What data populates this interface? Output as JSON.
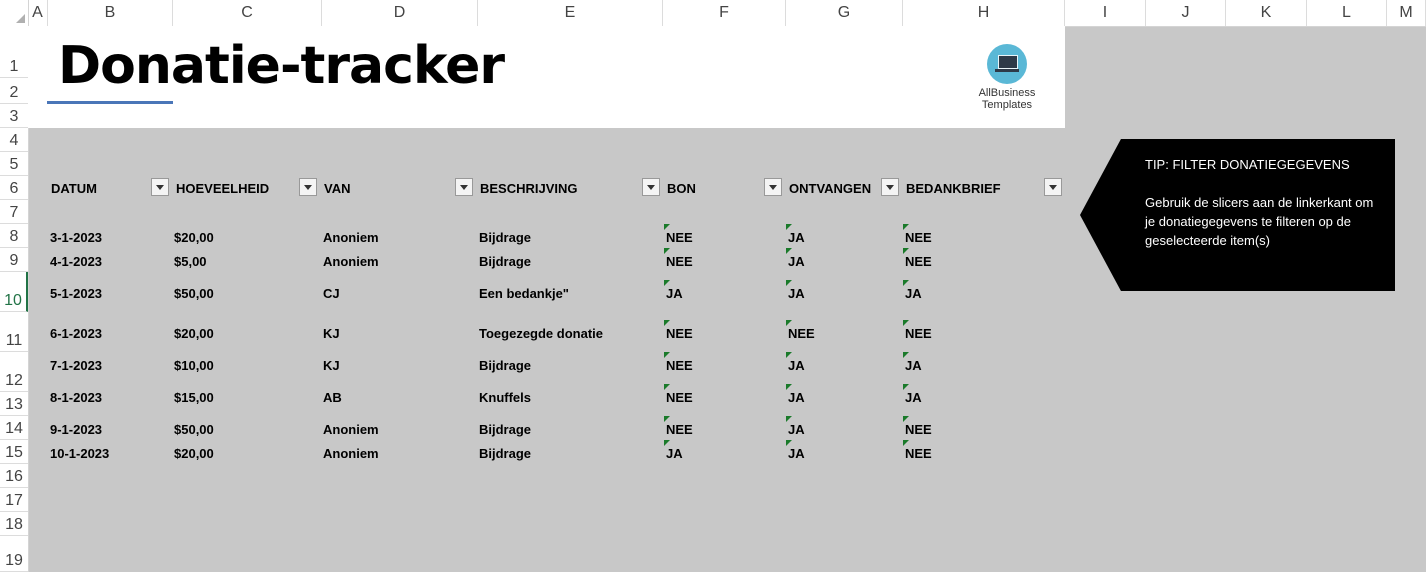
{
  "columns": [
    "A",
    "B",
    "C",
    "D",
    "E",
    "F",
    "G",
    "H",
    "I",
    "J",
    "K",
    "L",
    "M"
  ],
  "rows": [
    "1",
    "2",
    "3",
    "4",
    "5",
    "6",
    "7",
    "8",
    "9",
    "10",
    "11",
    "12",
    "13",
    "14",
    "15",
    "16",
    "17",
    "18",
    "19"
  ],
  "active_row": "10",
  "banner": {
    "title": "Donatie-tracker",
    "logo_line1": "AllBusiness",
    "logo_line2": "Templates"
  },
  "table": {
    "headers": [
      "DATUM",
      "HOEVEELHEID",
      "VAN",
      "BESCHRIJVING",
      "BON",
      "ONTVANGEN",
      "BEDANKBRIEF"
    ],
    "rows": [
      [
        "3-1-2023",
        "$20,00",
        "Anoniem",
        "Bijdrage",
        "NEE",
        "JA",
        "NEE"
      ],
      [
        "4-1-2023",
        "$5,00",
        "Anoniem",
        "Bijdrage",
        "NEE",
        "JA",
        "NEE"
      ],
      [
        "5-1-2023",
        "$50,00",
        "CJ",
        "Een bedankje\"",
        "JA",
        "JA",
        "JA"
      ],
      [
        "6-1-2023",
        "$20,00",
        "KJ",
        "Toegezegde donatie",
        "NEE",
        "NEE",
        "NEE"
      ],
      [
        "7-1-2023",
        "$10,00",
        "KJ",
        "Bijdrage",
        "NEE",
        "JA",
        "JA"
      ],
      [
        "8-1-2023",
        "$15,00",
        "AB",
        "Knuffels",
        "NEE",
        "JA",
        "JA"
      ],
      [
        "9-1-2023",
        "$50,00",
        "Anoniem",
        "Bijdrage",
        "NEE",
        "JA",
        "NEE"
      ],
      [
        "10-1-2023",
        "$20,00",
        "Anoniem",
        "Bijdrage",
        "JA",
        "JA",
        "NEE"
      ]
    ]
  },
  "tip": {
    "title": "TIP: FILTER DONATIEGEGEVENS",
    "body": "Gebruik de slicers aan de linkerkant om je donatiegegevens te filteren op de geselecteerde item(s)"
  },
  "colors": {
    "accent_underline": "#4a76b8",
    "active_row": "#217346",
    "error_flag": "#1a7a2a"
  }
}
